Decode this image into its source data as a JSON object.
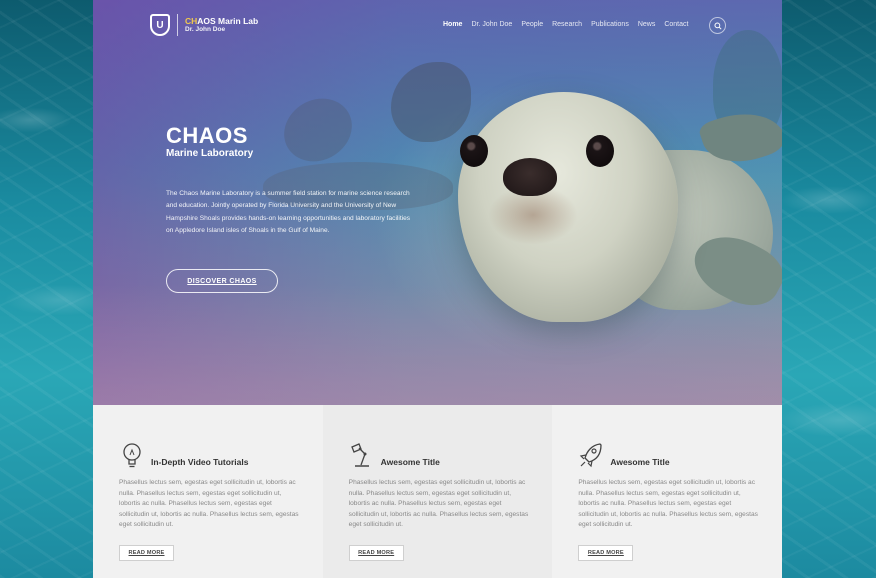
{
  "brand": {
    "badge_letter": "U",
    "title_accent": "CH",
    "title_rest": "AOS Marin Lab",
    "subtitle": "Dr. John Doe"
  },
  "nav": {
    "items": [
      "Home",
      "Dr. John Doe",
      "People",
      "Research",
      "Publications",
      "News",
      "Contact"
    ],
    "active": "Home",
    "search_icon": "search-icon"
  },
  "hero": {
    "title": "CHAOS",
    "subtitle": "Marine Laboratory",
    "description": "The Chaos Marine Laboratory is a summer field station for marine science research and education. Jointly operated by Florida University and the University of New Hampshire Shoals provides hands-on learning opportunities and laboratory facilities on Appledore Island isles of Shoals in the Gulf of Maine.",
    "button": "DISCOVER CHAOS"
  },
  "features": [
    {
      "icon": "lightbulb-icon",
      "title": "In-Depth Video Tutorials",
      "text": "Phasellus lectus sem, egestas eget sollicitudin ut, lobortis ac nulla. Phasellus lectus sem, egestas eget sollicitudin ut, lobortis ac nulla. Phasellus lectus sem, egestas eget sollicitudin ut, lobortis ac nulla. Phasellus lectus sem, egestas eget sollicitudin ut.",
      "button": "READ MORE"
    },
    {
      "icon": "desk-lamp-icon",
      "title": "Awesome Title",
      "text": "Phasellus lectus sem, egestas eget sollicitudin ut, lobortis ac nulla. Phasellus lectus sem, egestas eget sollicitudin ut, lobortis ac nulla. Phasellus lectus sem, egestas eget sollicitudin ut, lobortis ac nulla. Phasellus lectus sem, egestas eget sollicitudin ut.",
      "button": "READ MORE"
    },
    {
      "icon": "rocket-icon",
      "title": "Awesome Title",
      "text": "Phasellus lectus sem, egestas eget sollicitudin ut, lobortis ac nulla. Phasellus lectus sem, egestas eget sollicitudin ut, lobortis ac nulla. Phasellus lectus sem, egestas eget sollicitudin ut, lobortis ac nulla. Phasellus lectus sem, egestas eget sollicitudin ut.",
      "button": "READ MORE"
    }
  ],
  "colors": {
    "accent": "#f2c94c",
    "feature_bg": "#f1f1f1",
    "feature_bg_alt": "#ebebeb",
    "text_muted": "#888888"
  }
}
